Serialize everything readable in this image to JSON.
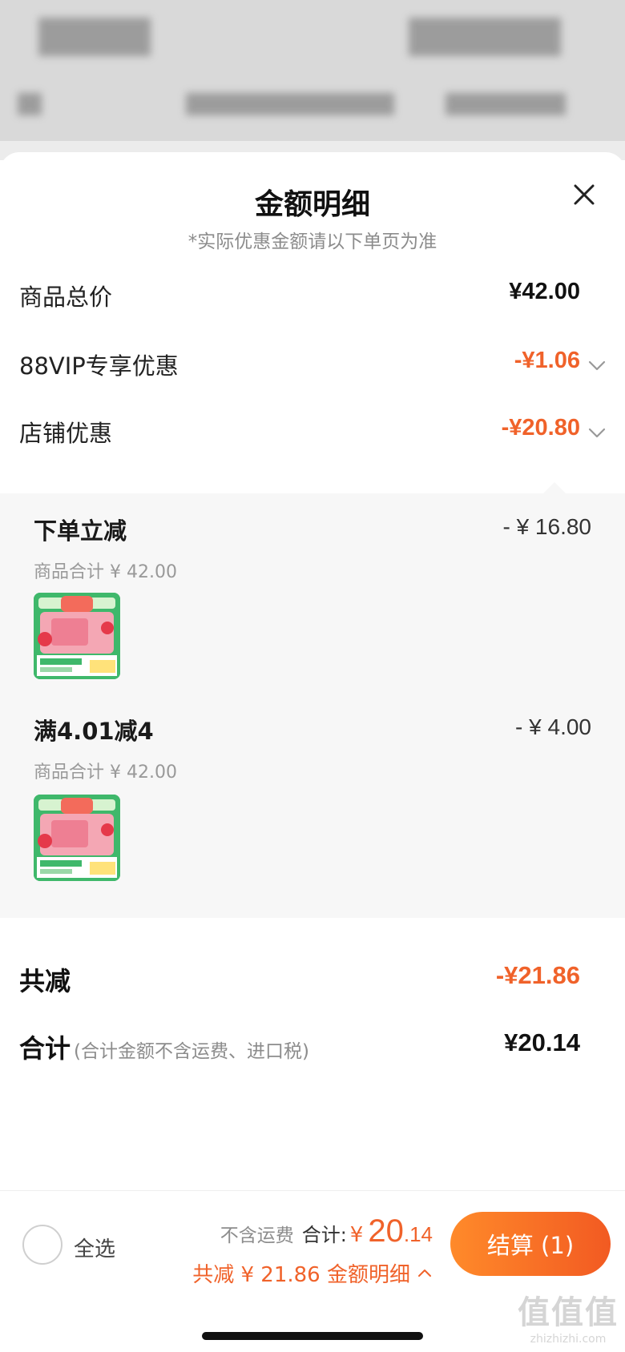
{
  "sheet": {
    "title": "金额明细",
    "subtitle": "*实际优惠金额请以下单页为准"
  },
  "rows": {
    "goods_total": {
      "label": "商品总价",
      "value": "¥42.00"
    },
    "vip": {
      "label": "88VIP专享优惠",
      "value": "-¥1.06"
    },
    "shop": {
      "label": "店铺优惠",
      "value": "-¥20.80"
    }
  },
  "promos": [
    {
      "title": "下单立减",
      "amount": "- ¥ 16.80",
      "sub": "商品合计 ¥ 42.00"
    },
    {
      "title": "满4.01减4",
      "amount": "- ¥ 4.00",
      "sub": "商品合计 ¥ 42.00"
    }
  ],
  "summary": {
    "reduction_label": "共减",
    "reduction_value": "-¥21.86",
    "total_label": "合计",
    "total_note": "(合计金额不含运费、进口税)",
    "total_value": "¥20.14"
  },
  "bottom_bar": {
    "select_all": "全选",
    "shipping_note": "不含运费",
    "total_caption": "合计:",
    "currency": "¥",
    "price_int": "20",
    "price_dec": ".14",
    "detail_text": "共减 ¥ 21.86  金额明细",
    "checkout": "结算 (1)"
  },
  "watermark": {
    "top": "值值值",
    "bottom": "zhizhizhi.com"
  },
  "colors": {
    "accent": "#f0622a",
    "panel_bg": "#f7f7f7",
    "thumb_green": "#3fb86b"
  },
  "icons": {
    "close": "close-icon",
    "chevron": "chevron-down-icon",
    "caret_up": "chevron-up-icon"
  }
}
